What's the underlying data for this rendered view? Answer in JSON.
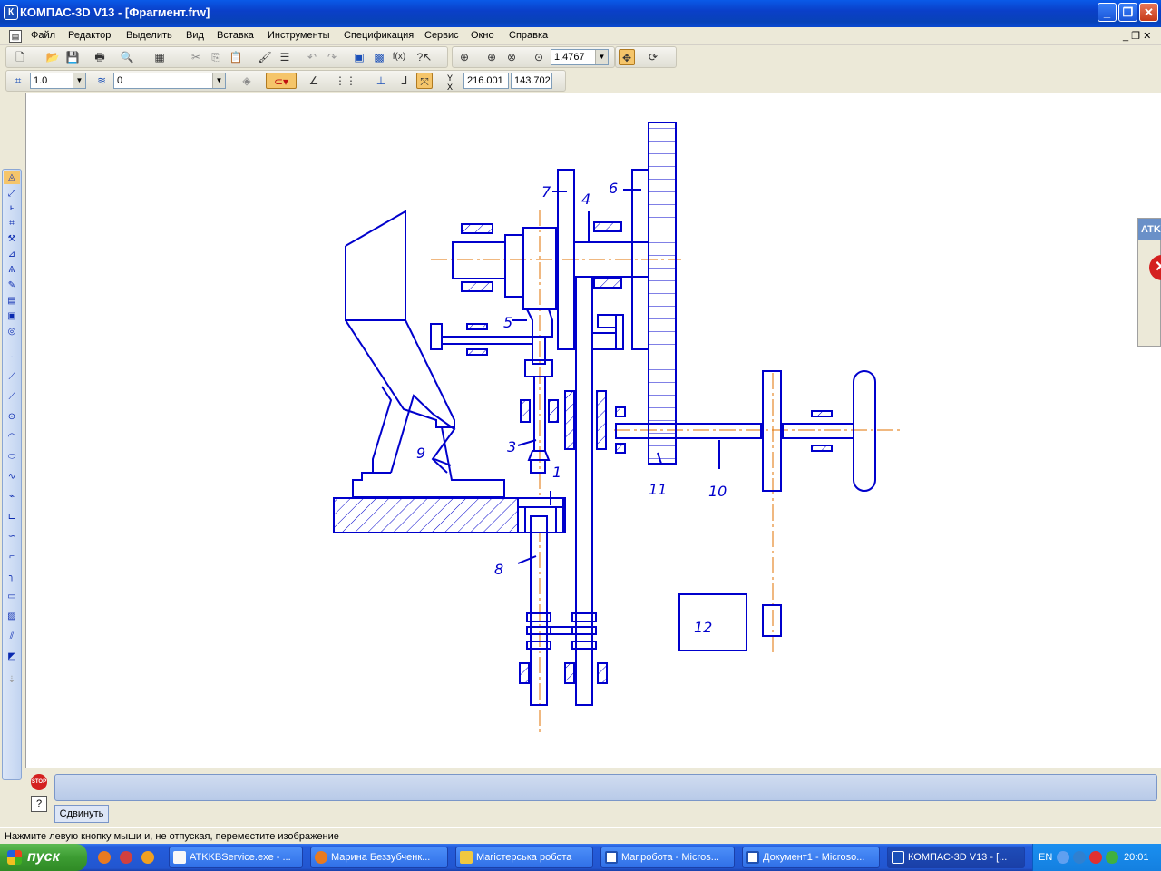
{
  "window": {
    "title": "КОМПАС-3D V13 - [Фрагмент.frw]",
    "app_icon": "К"
  },
  "menu": [
    "Файл",
    "Редактор",
    "Выделить",
    "Вид",
    "Вставка",
    "Инструменты",
    "Спецификация",
    "Сервис",
    "Окно",
    "Справка"
  ],
  "toolbar": {
    "zoom_value": "1.4767",
    "step_value": "1.0",
    "layer_value": "0",
    "coord_x": "216.001",
    "coord_y": "143.702",
    "fx_label": "f(x)"
  },
  "drawing": {
    "labels": [
      "1",
      "3",
      "4",
      "5",
      "6",
      "7",
      "8",
      "9",
      "10",
      "11",
      "12"
    ]
  },
  "bottom_panel": {
    "tab_label": "Сдвинуть",
    "stop_label": "STOP",
    "help_label": "?"
  },
  "status_text": "Нажмите левую кнопку мыши и, не отпуская, переместите изображение",
  "taskbar": {
    "start_label": "пуск",
    "tasks": [
      {
        "label": "ATKKBService.exe - ...",
        "color": "#f8f8f8"
      },
      {
        "label": "Марина Беззубченк...",
        "color": "#e87a20"
      },
      {
        "label": "Магістерська робота",
        "color": "#f0c840"
      },
      {
        "label": "Маг.робота - Micros...",
        "color": "#2050b0"
      },
      {
        "label": "Документ1 - Microso...",
        "color": "#2050b0"
      },
      {
        "label": "КОМПАС-3D V13 - [...",
        "color": "#1a4fb8"
      }
    ],
    "lang": "EN",
    "clock": "20:01"
  },
  "side_popup": {
    "title": "ATK"
  },
  "colors": {
    "drawing_line": "#0000cc",
    "axis_line": "#e07000"
  }
}
